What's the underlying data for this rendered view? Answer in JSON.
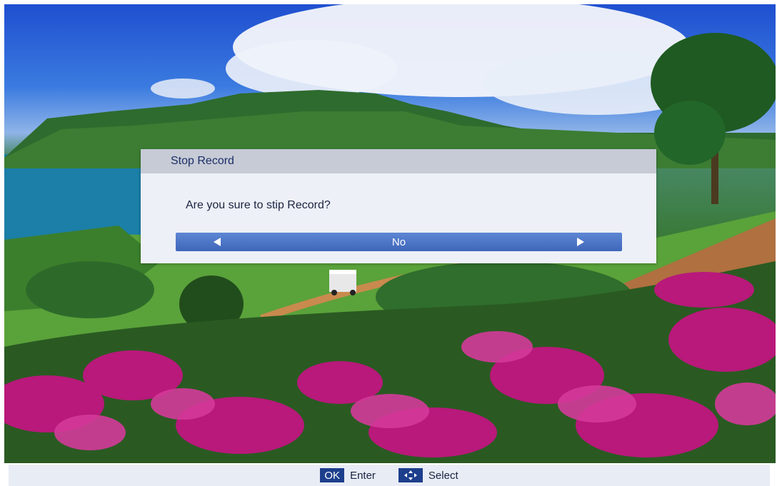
{
  "dialog": {
    "title": "Stop Record",
    "message": "Are you sure to stip Record?",
    "selected_option": "No"
  },
  "hints": {
    "ok_key": "OK",
    "ok_label": "Enter",
    "select_label": "Select"
  },
  "icons": {
    "left": "arrow-left-icon",
    "right": "arrow-right-icon",
    "navigate": "dpad-icon"
  },
  "colors": {
    "selector_bar": "#4a73c4",
    "key_badge": "#1c3e8c",
    "dialog_bg": "#edf0f7",
    "header_bg": "#c7cbd6"
  }
}
